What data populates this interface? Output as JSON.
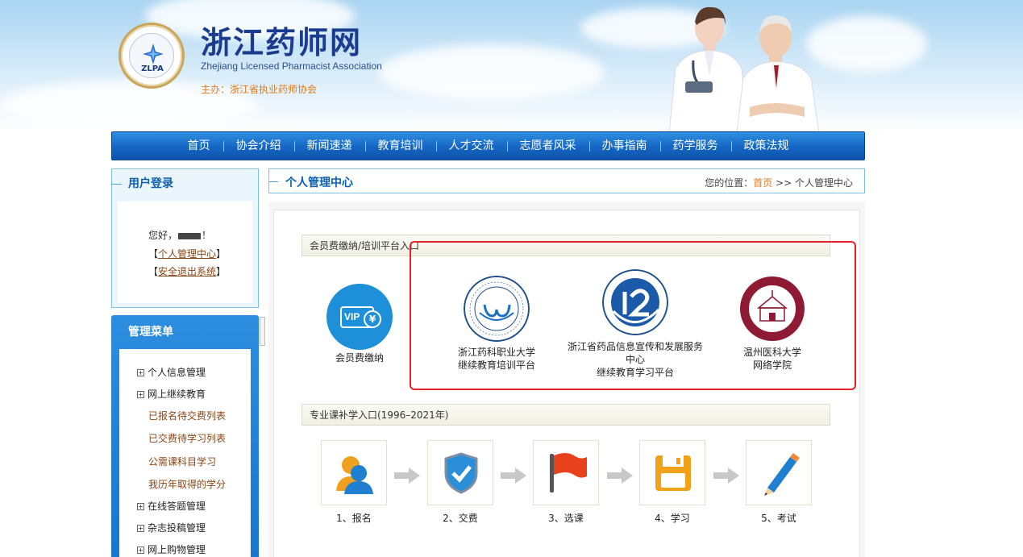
{
  "header": {
    "title": "浙江药师网",
    "subtitle": "Zhejiang Licensed Pharmacist Association",
    "host": "主办：浙江省执业药师协会",
    "logo_abbr": "ZLPA",
    "logo_ring_text": "浙江省执业药师协会"
  },
  "nav": {
    "items": [
      "首页",
      "协会介绍",
      "新闻速递",
      "教育培训",
      "人才交流",
      "志愿者风采",
      "办事指南",
      "药学服务",
      "政策法规"
    ]
  },
  "login": {
    "heading": "用户登录",
    "greeting_prefix": "您好，",
    "greeting_suffix": "！",
    "personal_center_link": "个人管理中心",
    "logout_link": "安全退出系统"
  },
  "menu": {
    "heading": "管理菜单",
    "items": [
      {
        "label": "个人信息管理",
        "type": "group"
      },
      {
        "label": "网上继续教育",
        "type": "group"
      },
      {
        "label": "已报名待交费列表",
        "type": "sub"
      },
      {
        "label": "已交费待学习列表",
        "type": "sub"
      },
      {
        "label": "公需课科目学习",
        "type": "sub"
      },
      {
        "label": "我历年取得的学分",
        "type": "sub"
      },
      {
        "label": "在线答题管理",
        "type": "group"
      },
      {
        "label": "杂志投稿管理",
        "type": "group"
      },
      {
        "label": "网上购物管理",
        "type": "group"
      }
    ]
  },
  "breadcrumb": {
    "title": "个人管理中心",
    "prefix": "您的位置：",
    "home": "首页",
    "separator": ">>",
    "current": "个人管理中心"
  },
  "fee_section": {
    "heading": "会员费缴纳/培训平台入口",
    "entries": [
      {
        "line1": "会员费缴纳",
        "line2": "",
        "line3": "",
        "icon": "vip-card-icon"
      },
      {
        "line1": "浙江药科职业大学",
        "line2": "继续教育培训平台",
        "line3": "",
        "icon": "zhejiang-pharmaceutical-university-seal"
      },
      {
        "line1": "浙江省药品信息宣传和发展服务",
        "line2": "中心",
        "line3": "继续教育学习平台",
        "icon": "medical-products-service-center-logo"
      },
      {
        "line1": "温州医科大学",
        "line2": "网络学院",
        "line3": "",
        "icon": "wenzhou-medical-university-seal"
      }
    ],
    "vip_text": "VIP",
    "yen_text": "¥"
  },
  "course_section": {
    "heading": "专业课补学入口(1996–2021年)",
    "steps": [
      {
        "label": "1、报名",
        "icon": "user-icon"
      },
      {
        "label": "2、交费",
        "icon": "shield-check-icon"
      },
      {
        "label": "3、选课",
        "icon": "flag-icon"
      },
      {
        "label": "4、学习",
        "icon": "floppy-disk-icon"
      },
      {
        "label": "5、考试",
        "icon": "pencil-icon"
      }
    ]
  },
  "colors": {
    "nav_blue": "#1566c4",
    "accent_orange": "#e07a1c",
    "highlight_red": "#e3232c",
    "link_brown": "#8b4513"
  }
}
